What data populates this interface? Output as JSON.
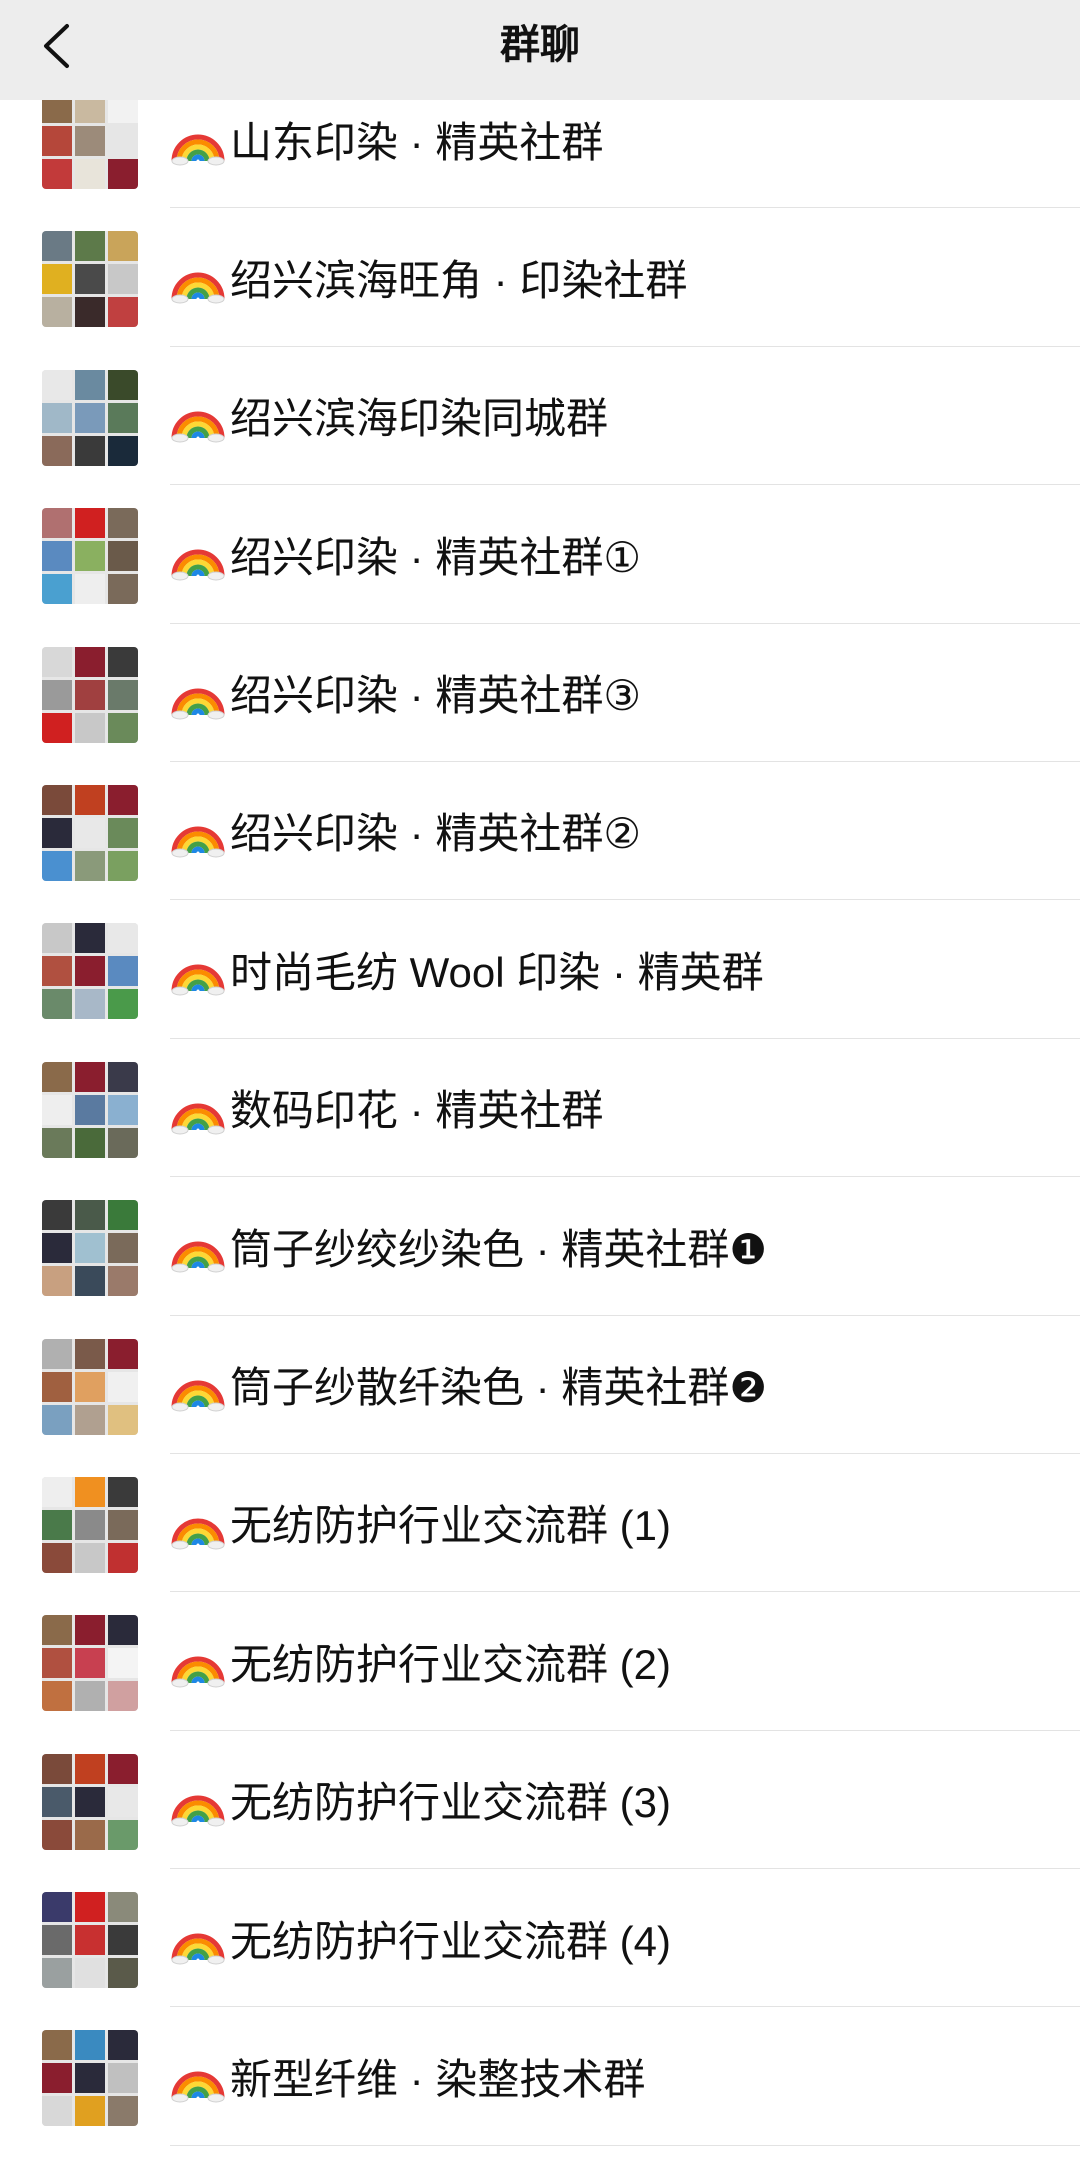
{
  "nav": {
    "title": "群聊"
  },
  "groups": [
    {
      "name": "山东印染 · 精英社群",
      "avatar_colors": [
        "#8a6a4a",
        "#c9b9a0",
        "#f2f2f2",
        "#b5473a",
        "#9c8b7a",
        "#e6e6e6",
        "#c23a3a",
        "#e8e4da",
        "#8a1e2e"
      ]
    },
    {
      "name": "绍兴滨海旺角 · 印染社群",
      "avatar_colors": [
        "#6a7a85",
        "#5d7a4a",
        "#c9a45a",
        "#e0b020",
        "#4a4a4a",
        "#c8c8c8",
        "#b8b0a0",
        "#3a2a2a",
        "#c04040"
      ]
    },
    {
      "name": "绍兴滨海印染同城群",
      "avatar_colors": [
        "#e8e8e8",
        "#6a8aa0",
        "#3a4a2a",
        "#a0b8c8",
        "#7a9aba",
        "#5a7a5a",
        "#8a6a5a",
        "#3a3a3a",
        "#1a2a3a"
      ]
    },
    {
      "name": "绍兴印染 · 精英社群①",
      "avatar_colors": [
        "#b07070",
        "#d02020",
        "#7a6a5a",
        "#5a8ac0",
        "#8ab060",
        "#6a5a4a",
        "#4aa0d0",
        "#eeeeee",
        "#7a6a5a"
      ]
    },
    {
      "name": "绍兴印染 · 精英社群③",
      "avatar_colors": [
        "#d8d8d8",
        "#8a1e2e",
        "#3a3a3a",
        "#9a9a9a",
        "#a04040",
        "#6a7a6a",
        "#d02020",
        "#c8c8c8",
        "#6a8a5a"
      ]
    },
    {
      "name": "绍兴印染 · 精英社群②",
      "avatar_colors": [
        "#7a4a3a",
        "#c04020",
        "#8a1e2e",
        "#2a2a3a",
        "#e8e8e8",
        "#6a8a5a",
        "#4a90d0",
        "#8a9a7a",
        "#7aa060"
      ]
    },
    {
      "name": "时尚毛纺 Wool 印染 · 精英群",
      "avatar_colors": [
        "#c8c8c8",
        "#2a2a3a",
        "#e8e8e8",
        "#b05040",
        "#8a1e2e",
        "#5a8ac0",
        "#6a8a6a",
        "#a8b8c8",
        "#4a9a4a"
      ]
    },
    {
      "name": "数码印花 · 精英社群",
      "avatar_colors": [
        "#8a6a4a",
        "#8a1e2e",
        "#3a3a4a",
        "#eeeeee",
        "#5a7aa0",
        "#8ab0d0",
        "#6a7a5a",
        "#4a6a3a",
        "#6a6a5a"
      ]
    },
    {
      "name": "筒子纱绞纱染色 · 精英社群❶",
      "avatar_colors": [
        "#3a3a3a",
        "#4a5a4a",
        "#3a7a3a",
        "#2a2a3a",
        "#a0c0d0",
        "#7a6a5a",
        "#c8a080",
        "#3a4a5a",
        "#9a7a6a"
      ]
    },
    {
      "name": "筒子纱散纤染色 · 精英社群❷",
      "avatar_colors": [
        "#b0b0b0",
        "#7a5a4a",
        "#8a1e2e",
        "#a06040",
        "#e0a060",
        "#f0f0f0",
        "#7aa0c0",
        "#b0a090",
        "#e0c080"
      ]
    },
    {
      "name": "无纺防护行业交流群 (1)",
      "avatar_colors": [
        "#eeeeee",
        "#f09020",
        "#3a3a3a",
        "#4a7a4a",
        "#8a8a8a",
        "#7a6a5a",
        "#8a4a3a",
        "#c8c8c8",
        "#c03030"
      ]
    },
    {
      "name": "无纺防护行业交流群 (2)",
      "avatar_colors": [
        "#8a6a4a",
        "#8a1e2e",
        "#2a2a3a",
        "#b05040",
        "#c84050",
        "#f4f4f4",
        "#c07040",
        "#b0b0b0",
        "#d0a0a0"
      ]
    },
    {
      "name": "无纺防护行业交流群 (3)",
      "avatar_colors": [
        "#7a4a3a",
        "#c04020",
        "#8a1e2e",
        "#4a5a6a",
        "#2a2a3a",
        "#e8e8e8",
        "#8a4a3a",
        "#9a6a4a",
        "#6a9a6a"
      ]
    },
    {
      "name": "无纺防护行业交流群 (4)",
      "avatar_colors": [
        "#3a3a6a",
        "#d02020",
        "#8a8a7a",
        "#6a6a6a",
        "#c83030",
        "#3a3a3a",
        "#9aa0a0",
        "#e0e0e0",
        "#5a5a4a"
      ]
    },
    {
      "name": "新型纤维 · 染整技术群",
      "avatar_colors": [
        "#8a6a4a",
        "#3a8ac0",
        "#2a2a3a",
        "#8a1e2e",
        "#2a2a3a",
        "#c0c0c0",
        "#d8d8d8",
        "#e0a020",
        "#8a7a6a"
      ]
    }
  ]
}
